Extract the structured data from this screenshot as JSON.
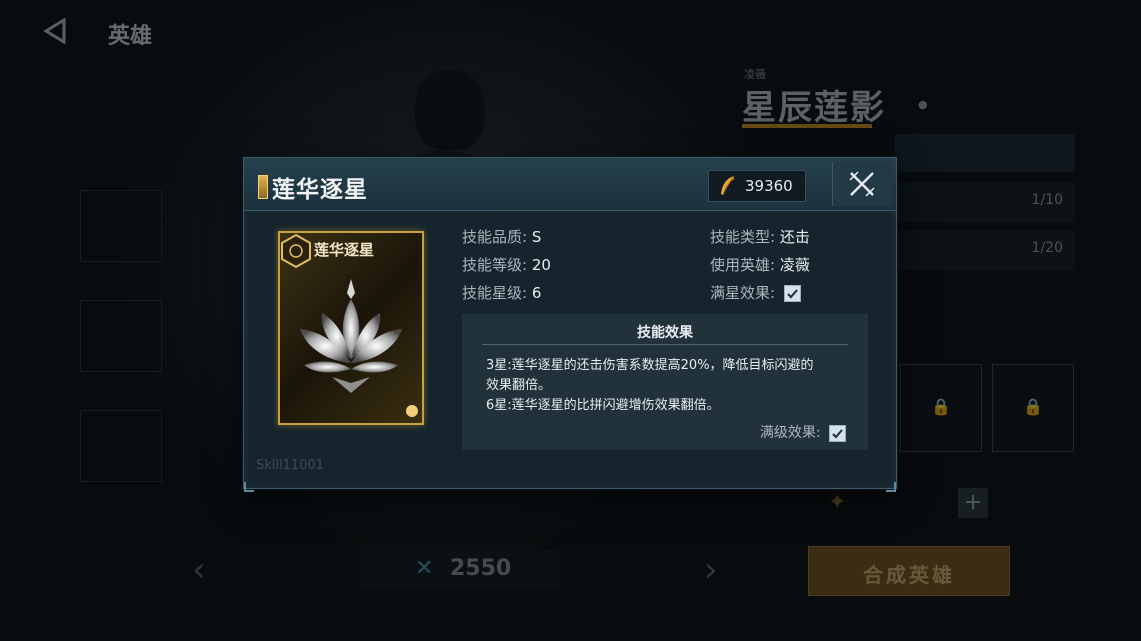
{
  "background": {
    "title": "英雄",
    "hero_subtitle": "凌薇",
    "hero_name": "星辰莲影",
    "right_rows": [
      "1/10",
      "1/20"
    ],
    "cost_value": "2550",
    "craft_label": "合成英雄",
    "skill_id": "Skill11001"
  },
  "modal": {
    "title": "莲华逐星",
    "currency_value": "39360",
    "card_title": "莲华逐星",
    "info": {
      "quality_label": "技能品质:",
      "quality_value": "S",
      "level_label": "技能等级:",
      "level_value": "20",
      "star_label": "技能星级:",
      "star_value": "6",
      "type_label": "技能类型:",
      "type_value": "还击",
      "hero_label": "使用英雄:",
      "hero_value": "凌薇",
      "fullstar_label": "满星效果:"
    },
    "effect": {
      "heading": "技能效果",
      "line1": "3星:莲华逐星的还击伤害系数提高20%，降低目标闪避的",
      "line2": "效果翻倍。",
      "line3": "6星:莲华逐星的比拼闪避增伤效果翻倍。",
      "maxlevel_label": "满级效果:"
    }
  },
  "colors": {
    "accent_gold": "#c9a13c",
    "panel": "#1b2a32",
    "header": "#25404d"
  },
  "icons": {
    "back": "back-arrow-icon",
    "currency": "feather-icon",
    "close": "close-icon",
    "check": "check-icon",
    "lock": "lock-icon"
  }
}
